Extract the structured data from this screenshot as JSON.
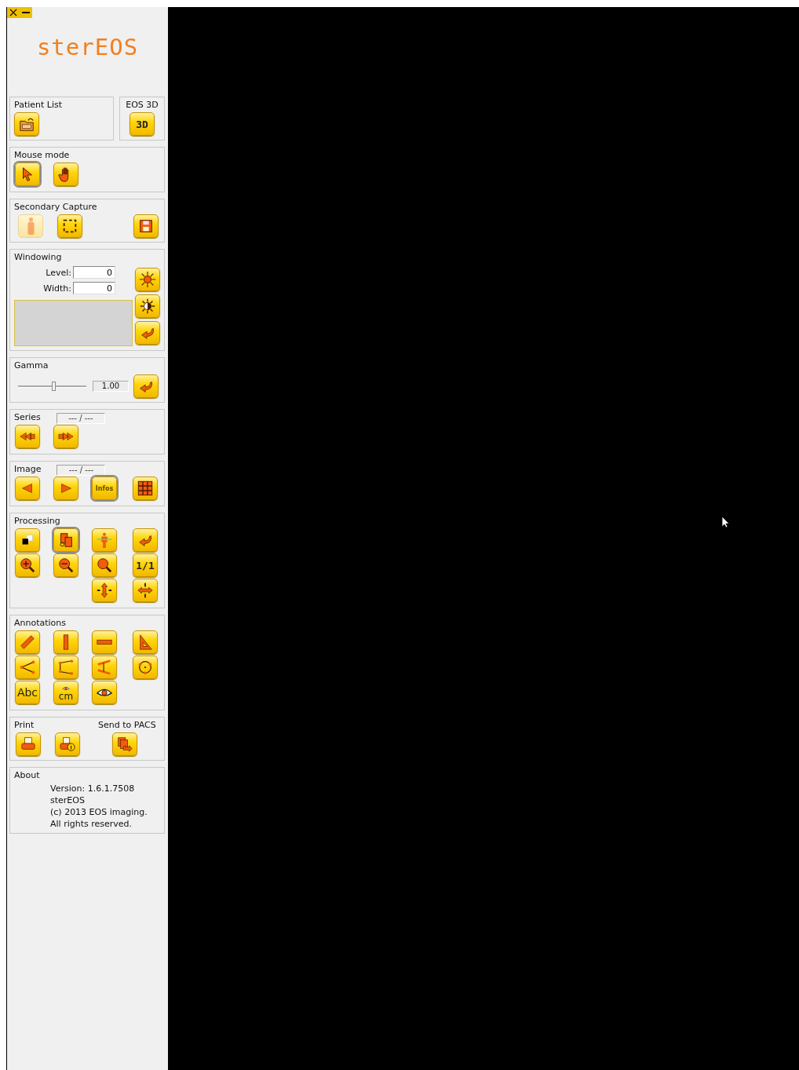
{
  "window_controls": [
    {
      "kind": "close"
    },
    {
      "kind": "minimize"
    }
  ],
  "logo": "sterEOS",
  "sections": [
    {
      "kind": "pair",
      "groups": [
        {
          "title": "Patient List",
          "buttons": [
            {
              "kind": "pacs"
            }
          ]
        },
        {
          "title": "EOS 3D",
          "buttons": [
            {
              "kind": "text",
              "label": "3D"
            }
          ]
        }
      ]
    },
    {
      "kind": "buttons",
      "title": "Mouse mode",
      "rows": [
        {
          "buttons": [
            {
              "kind": "pointer",
              "selected": true
            },
            {
              "kind": "hand",
              "selected": false
            }
          ]
        }
      ]
    },
    {
      "kind": "capture",
      "title": "Secondary Capture",
      "rows": [
        {
          "buttons": [
            {
              "kind": "figure",
              "disabled": true
            },
            {
              "kind": "selection",
              "disabled": false
            },
            {
              "kind": "save",
              "disabled": false
            }
          ]
        }
      ]
    },
    {
      "kind": "windowing",
      "title": "Windowing",
      "fields": [
        {
          "label": "Level:",
          "value": "0"
        },
        {
          "label": "Width:",
          "value": "0"
        }
      ],
      "buttons": [
        {
          "kind": "contrast"
        },
        {
          "kind": "brightness"
        },
        {
          "kind": "undo"
        }
      ]
    },
    {
      "kind": "gamma",
      "title": "Gamma",
      "slider": {
        "level": 0.52
      },
      "value": "1.00",
      "buttons": [
        {
          "kind": "undo"
        }
      ]
    },
    {
      "kind": "buttons",
      "title": "Series",
      "counter": "--- / ---",
      "rows": [
        {
          "buttons": [
            {
              "kind": "rewind"
            },
            {
              "kind": "forward"
            }
          ]
        }
      ]
    },
    {
      "kind": "buttons",
      "title": "Image",
      "counter": "--- / ---",
      "rows": [
        {
          "buttons": [
            {
              "kind": "prev",
              "selected": false
            },
            {
              "kind": "next",
              "selected": false
            },
            {
              "kind": "small-text",
              "label": "Infos",
              "selected": true
            },
            {
              "kind": "grid",
              "selected": false
            }
          ]
        }
      ]
    },
    {
      "kind": "buttons",
      "title": "Processing",
      "rows": [
        {
          "buttons": [
            {
              "kind": "invert",
              "selected": false
            },
            {
              "kind": "layers",
              "selected": true
            },
            {
              "kind": "figure-line",
              "selected": false
            },
            {
              "kind": "undo",
              "selected": false
            }
          ]
        },
        {
          "buttons": [
            {
              "kind": "zoom-in",
              "selected": false
            },
            {
              "kind": "zoom-out",
              "selected": false
            },
            {
              "kind": "zoom",
              "selected": false
            },
            {
              "kind": "text",
              "label": "1/1",
              "selected": false
            }
          ]
        },
        {
          "buttons": [
            {
              "kind": "vresize",
              "selected": false
            },
            {
              "kind": "hresize",
              "selected": false
            }
          ]
        }
      ]
    },
    {
      "kind": "buttons",
      "title": "Annotations",
      "rows": [
        {
          "buttons": [
            {
              "kind": "ruler"
            },
            {
              "kind": "vbar"
            },
            {
              "kind": "hbar"
            },
            {
              "kind": "triangle"
            }
          ]
        },
        {
          "buttons": [
            {
              "kind": "angle"
            },
            {
              "kind": "lines"
            },
            {
              "kind": "parallel"
            },
            {
              "kind": "circle"
            }
          ]
        },
        {
          "buttons": [
            {
              "kind": "big-text",
              "label": "Abc"
            },
            {
              "kind": "eye-text",
              "label": "cm"
            },
            {
              "kind": "eye"
            }
          ]
        }
      ]
    },
    {
      "kind": "split",
      "groups": [
        {
          "title": "Print",
          "buttons": [
            {
              "kind": "print"
            },
            {
              "kind": "print-info"
            }
          ]
        },
        {
          "title": "Send to PACS",
          "buttons": [
            {
              "kind": "send"
            }
          ]
        }
      ]
    },
    {
      "kind": "about",
      "title": "About",
      "lines": [
        "Version: 1.6.1.7508",
        "sterEOS",
        "(c) 2013 EOS imaging.",
        "All rights reserved."
      ]
    }
  ]
}
